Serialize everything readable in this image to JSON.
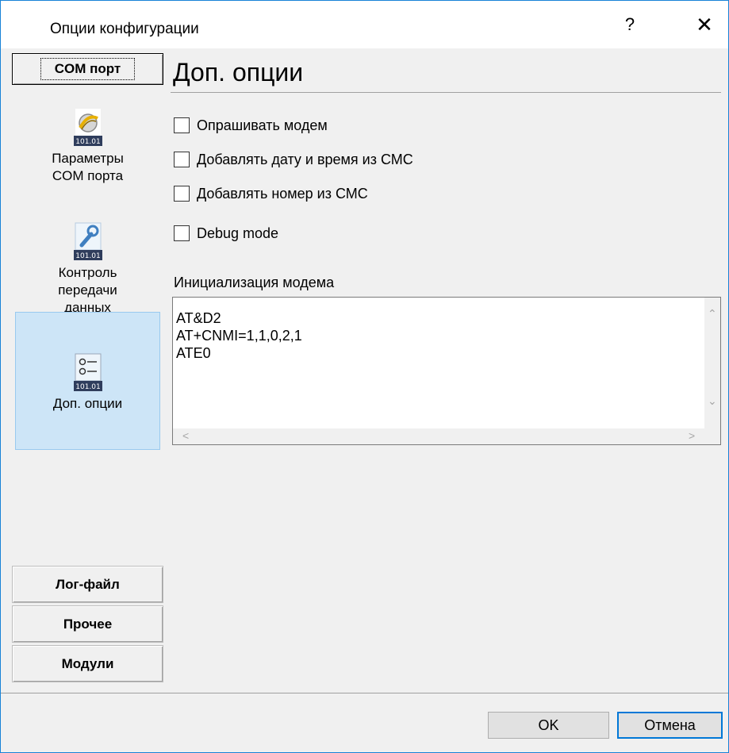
{
  "window": {
    "title": "Опции конфигурации",
    "help_glyph": "?",
    "close_glyph": "✕"
  },
  "sidebar": {
    "groups": {
      "com_port": "COM порт",
      "log_file": "Лог-файл",
      "other": "Прочее",
      "modules": "Модули"
    },
    "items": [
      {
        "label_line1": "Параметры",
        "label_line2": "COM порта",
        "icon": "plug-icon",
        "badge": "101.01"
      },
      {
        "label_line1": "Контроль",
        "label_line2": "передачи",
        "label_line3": "данных",
        "icon": "wrench-icon",
        "badge": "101.01"
      },
      {
        "label_line1": "Доп. опции",
        "icon": "options-list-icon",
        "badge": "101.01",
        "selected": true
      }
    ]
  },
  "panel": {
    "title": "Доп. опции",
    "checkboxes": [
      {
        "label": "Опрашивать модем",
        "checked": false
      },
      {
        "label": "Добавлять дату и время из СМС",
        "checked": false
      },
      {
        "label": "Добавлять номер из СМС",
        "checked": false
      },
      {
        "label": "Debug mode",
        "checked": false
      }
    ],
    "init_label": "Инициализация модема",
    "init_text": "AT&D2\nAT+CNMI=1,1,0,2,1\nATE0"
  },
  "buttons": {
    "ok": "OK",
    "cancel": "Отмена"
  },
  "colors": {
    "selection_bg": "#cde5f7",
    "selection_border": "#99c9ef",
    "accent": "#0078d7"
  }
}
